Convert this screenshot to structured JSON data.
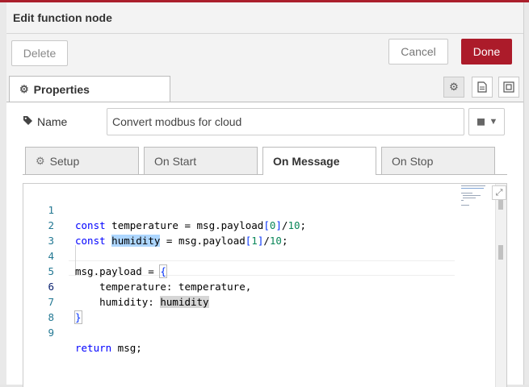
{
  "tray": {
    "title": "Edit function node"
  },
  "toolbar": {
    "delete_label": "Delete",
    "cancel_label": "Cancel",
    "done_label": "Done"
  },
  "properties_tab": {
    "label": "Properties",
    "icon": "gear-icon"
  },
  "side_icons": [
    "gear-icon",
    "description-icon",
    "appearance-icon"
  ],
  "name_field": {
    "label": "Name",
    "icon": "tag-icon",
    "value": "Convert modbus for cloud",
    "library_icon": "book-icon"
  },
  "sub_tabs": [
    {
      "label": "Setup",
      "icon": "gear-icon",
      "active": false
    },
    {
      "label": "On Start",
      "active": false
    },
    {
      "label": "On Message",
      "active": true
    },
    {
      "label": "On Stop",
      "active": false
    }
  ],
  "editor": {
    "line_numbers": [
      "1",
      "2",
      "3",
      "4",
      "5",
      "6",
      "7",
      "8",
      "9"
    ],
    "current_line": "6",
    "lines": [
      {
        "t": "const",
        "a": " temperature = msg.payload",
        "b": "[",
        "n": "0",
        "c": "]",
        "d": "/",
        "e": "10",
        "f": ";"
      },
      {
        "t": "const",
        "h": "humidity",
        "a": " = msg.payload",
        "b": "[",
        "n": "1",
        "c": "]",
        "d": "/",
        "e": "10",
        "f": ";"
      },
      {},
      {
        "a": "msg.payload = ",
        "b": "{"
      },
      {
        "a": "    temperature: temperature,"
      },
      {
        "a": "    humidity: ",
        "h": "humidity"
      },
      {
        "b": "}"
      },
      {},
      {
        "t": "return",
        "a": " msg;"
      }
    ]
  },
  "colors": {
    "accent": "#aa1f2c",
    "done_button": "#ac1b2a",
    "keyword": "#0000ff",
    "number": "#098658",
    "line_number": "#237893"
  }
}
